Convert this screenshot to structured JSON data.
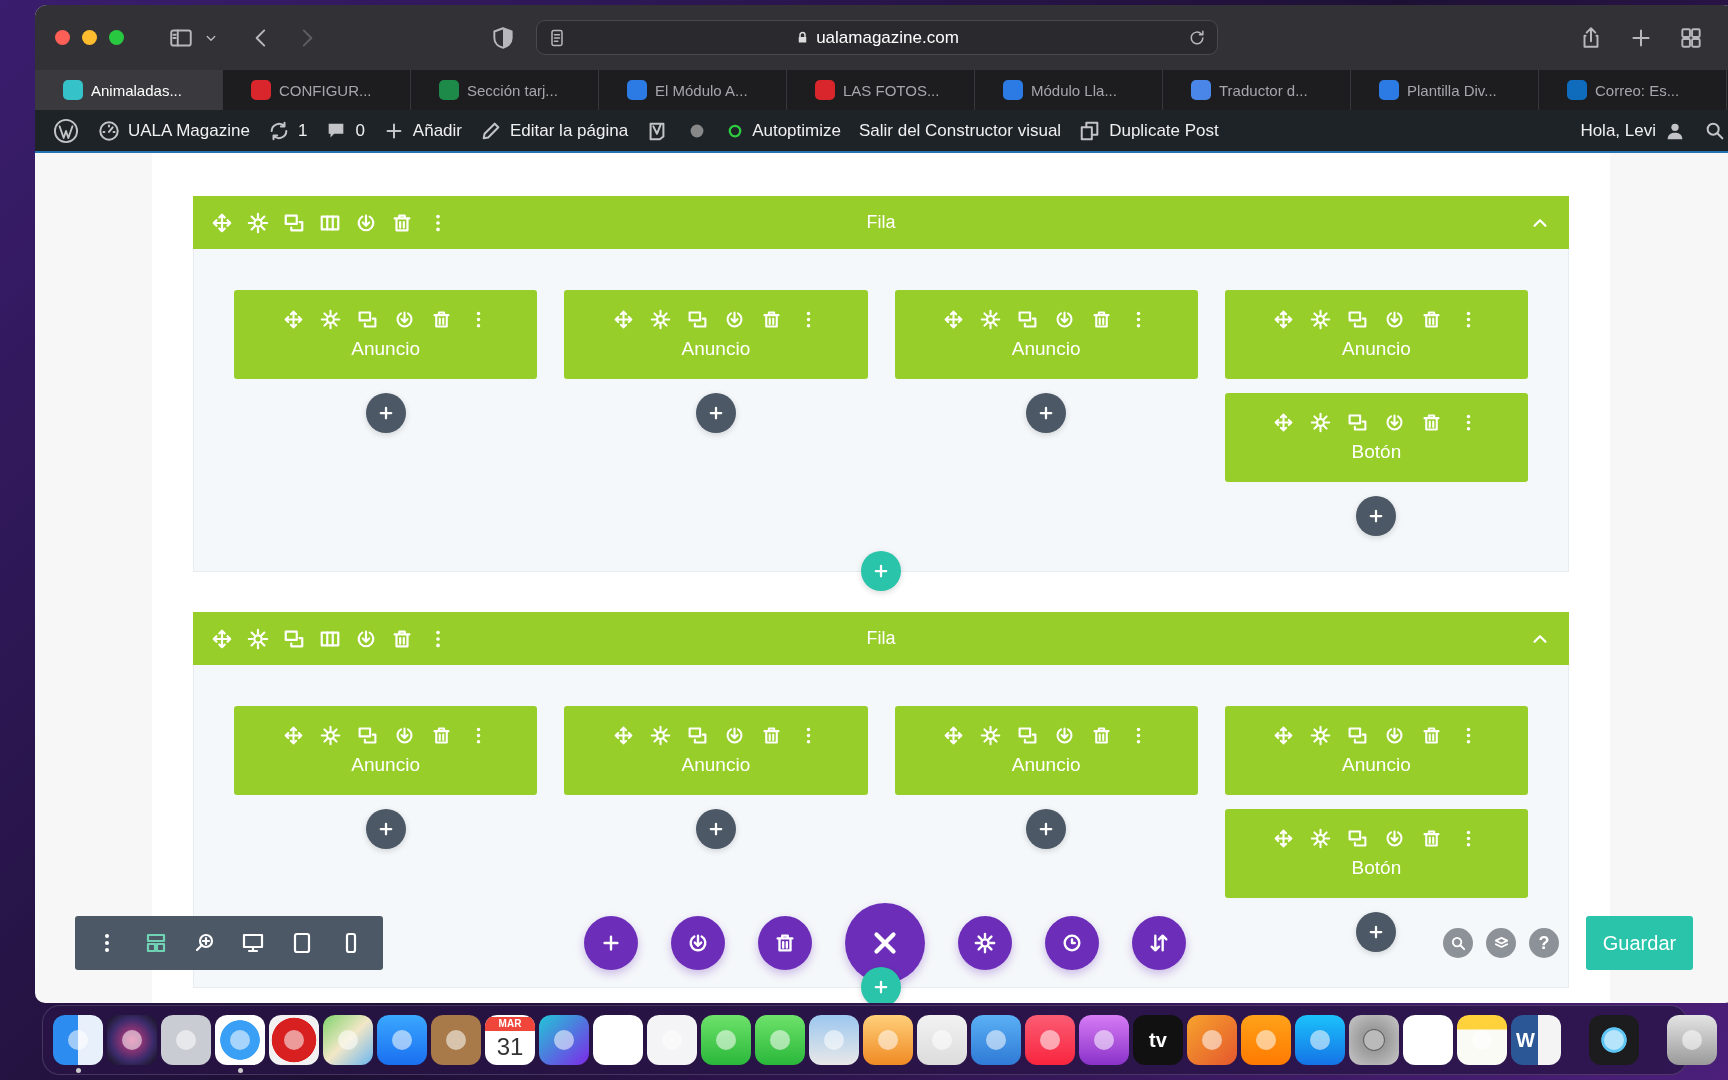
{
  "browser": {
    "url": "ualamagazine.com",
    "tabs": [
      {
        "title": "Animaladas...",
        "color": "#35c2c9",
        "selected": true
      },
      {
        "title": "CONFIGUR...",
        "color": "#d9262c",
        "selected": false
      },
      {
        "title": "Sección tarj...",
        "color": "#1d8a4a",
        "selected": false
      },
      {
        "title": "El Módulo A...",
        "color": "#2c7be5",
        "selected": false
      },
      {
        "title": "LAS FOTOS...",
        "color": "#d9262c",
        "selected": false
      },
      {
        "title": "Módulo Lla...",
        "color": "#2c7be5",
        "selected": false
      },
      {
        "title": "Traductor d...",
        "color": "#4a86e8",
        "selected": false
      },
      {
        "title": "Plantilla Div...",
        "color": "#2c7be5",
        "selected": false
      },
      {
        "title": "Correo: Es...",
        "color": "#0f6cbd",
        "selected": false
      }
    ]
  },
  "admin_bar": {
    "items": [
      {
        "kind": "wordpress"
      },
      {
        "kind": "site",
        "label": "UALA Magazine"
      },
      {
        "kind": "updates",
        "label": "1"
      },
      {
        "kind": "comments",
        "label": "0"
      },
      {
        "kind": "new",
        "label": "Añadir"
      },
      {
        "kind": "edit",
        "label": "Editar la página"
      },
      {
        "kind": "seo"
      },
      {
        "kind": "status"
      },
      {
        "kind": "autoptimize",
        "label": "Autoptimize"
      },
      {
        "kind": "exit",
        "label": "Salir del Constructor visual"
      },
      {
        "kind": "duplicate",
        "label": "Duplicate Post"
      }
    ],
    "greeting": "Hola, Levi"
  },
  "rows": [
    {
      "title": "Fila",
      "columns": [
        [
          {
            "label": "Anuncio"
          }
        ],
        [
          {
            "label": "Anuncio"
          }
        ],
        [
          {
            "label": "Anuncio"
          }
        ],
        [
          {
            "label": "Anuncio"
          },
          {
            "label": "Botón"
          }
        ]
      ]
    },
    {
      "title": "Fila",
      "columns": [
        [
          {
            "label": "Anuncio"
          }
        ],
        [
          {
            "label": "Anuncio"
          }
        ],
        [
          {
            "label": "Anuncio"
          }
        ],
        [
          {
            "label": "Anuncio"
          },
          {
            "label": "Botón"
          }
        ]
      ]
    }
  ],
  "builder_bar": {
    "help": "?",
    "save": "Guardar"
  },
  "dock": [
    {
      "kind": "finder",
      "running": true
    },
    {
      "kind": "siri",
      "running": false
    },
    {
      "kind": "launchpad",
      "running": false
    },
    {
      "kind": "safari",
      "running": true
    },
    {
      "kind": "youtube",
      "running": false
    },
    {
      "kind": "maps",
      "running": false
    },
    {
      "kind": "mail",
      "running": false
    },
    {
      "kind": "contacts",
      "running": false
    },
    {
      "kind": "calendar",
      "month": "MAR",
      "day": "31",
      "running": false
    },
    {
      "kind": "canva",
      "running": false
    },
    {
      "kind": "photos",
      "running": false
    },
    {
      "kind": "imovie",
      "running": false
    },
    {
      "kind": "messages",
      "running": false
    },
    {
      "kind": "facetime",
      "running": false
    },
    {
      "kind": "preview",
      "running": false
    },
    {
      "kind": "pages",
      "running": false
    },
    {
      "kind": "numbers",
      "running": false
    },
    {
      "kind": "keynote",
      "running": false
    },
    {
      "kind": "music",
      "running": false
    },
    {
      "kind": "podcasts",
      "running": false
    },
    {
      "kind": "tv",
      "text": "tv",
      "running": false
    },
    {
      "kind": "sketchbook",
      "running": false
    },
    {
      "kind": "books",
      "running": false
    },
    {
      "kind": "appstore",
      "running": false
    },
    {
      "kind": "settings",
      "running": false
    },
    {
      "kind": "reminders",
      "running": false
    },
    {
      "kind": "notes",
      "running": false
    },
    {
      "kind": "word",
      "text": "W",
      "running": false
    },
    {
      "kind": "separator"
    },
    {
      "kind": "quicktime",
      "running": false
    },
    {
      "kind": "separator"
    },
    {
      "kind": "trash",
      "running": false
    }
  ]
}
